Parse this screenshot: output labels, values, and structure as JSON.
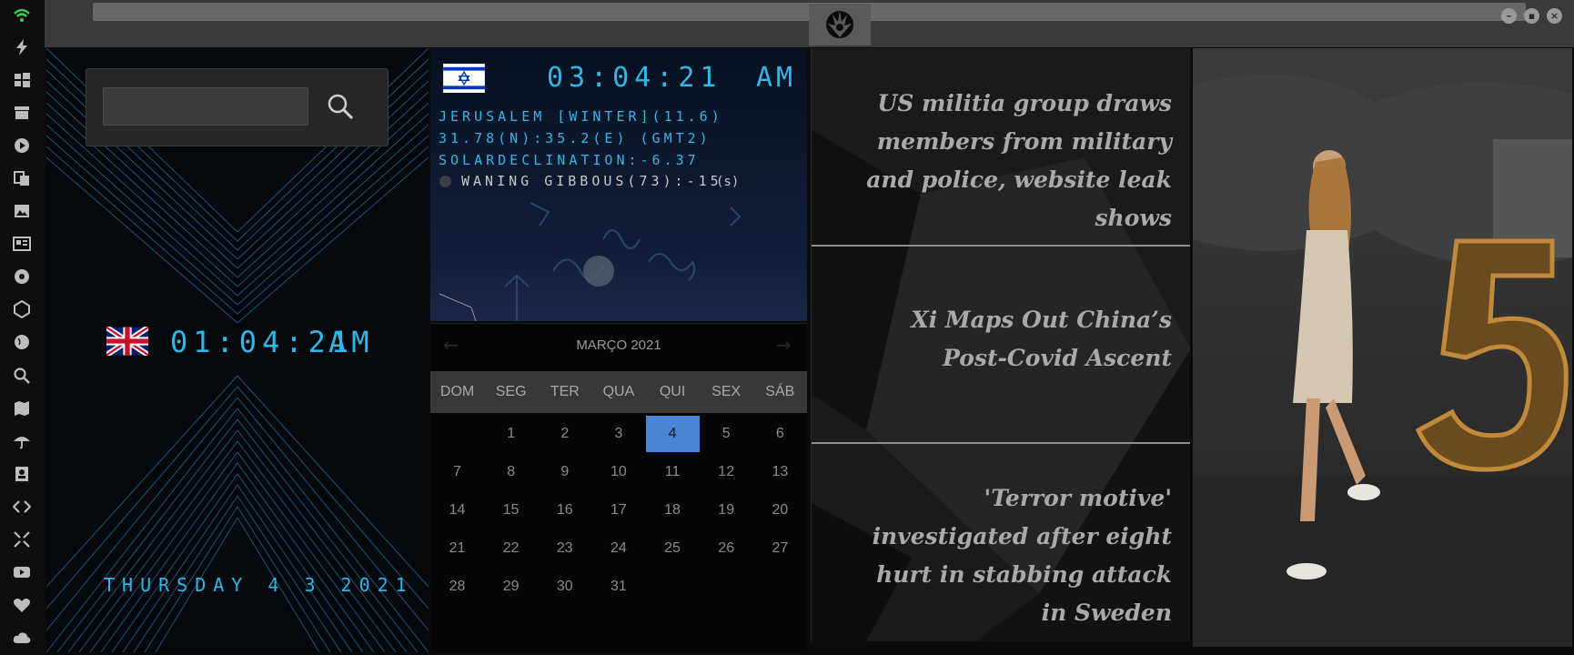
{
  "rail": {
    "icons": [
      "wifi-icon",
      "lightning-icon",
      "windows-icon",
      "archive-icon",
      "play-icon",
      "translate-icon",
      "image-icon",
      "newspaper-icon",
      "settings-badge-icon",
      "hexagon-icon",
      "globe-icon",
      "search-icon",
      "map-icon",
      "umbrella-icon",
      "contacts-icon",
      "code-icon",
      "fullscreen-icon",
      "youtube-icon",
      "heart-icon",
      "cloud-icon"
    ]
  },
  "window": {
    "title": ""
  },
  "world_clock": {
    "search_placeholder": "",
    "uk_time": "01:04:21",
    "uk_ampm": "AM",
    "date_text": "THURSDAY 4 3 2021"
  },
  "israel_clock": {
    "time": "03:04:21",
    "ampm": "AM",
    "line1": "JERUSALEM [WINTER](11.6)",
    "line2": "31.78(N):35.2(E) (GMT2)",
    "line3": "SOLARDECLINATION:-6.37",
    "moon_text": "WANING GIBBOUS(73):-15",
    "moon_unit": "(s)"
  },
  "calendar": {
    "month_label": "MARÇO 2021",
    "day_names": [
      "DOM",
      "SEG",
      "TER",
      "QUA",
      "QUI",
      "SEX",
      "SÁB"
    ],
    "first_weekday": 1,
    "days_in_month": 31,
    "today": 4,
    "today_color": "#4a86d3"
  },
  "news": {
    "headlines": [
      "US militia group draws members from military and police, website leak shows",
      "Xi Maps Out China’s Post-Covid Ascent",
      "'Terror motive' investigated after eight hurt in stabbing attack in Sweden"
    ]
  },
  "photo": {
    "subject": "fashion-photo-woman-with-lit-number-5"
  },
  "colors": {
    "accent_lcd": "#2fb7e8",
    "wifi": "#3ec85a"
  }
}
